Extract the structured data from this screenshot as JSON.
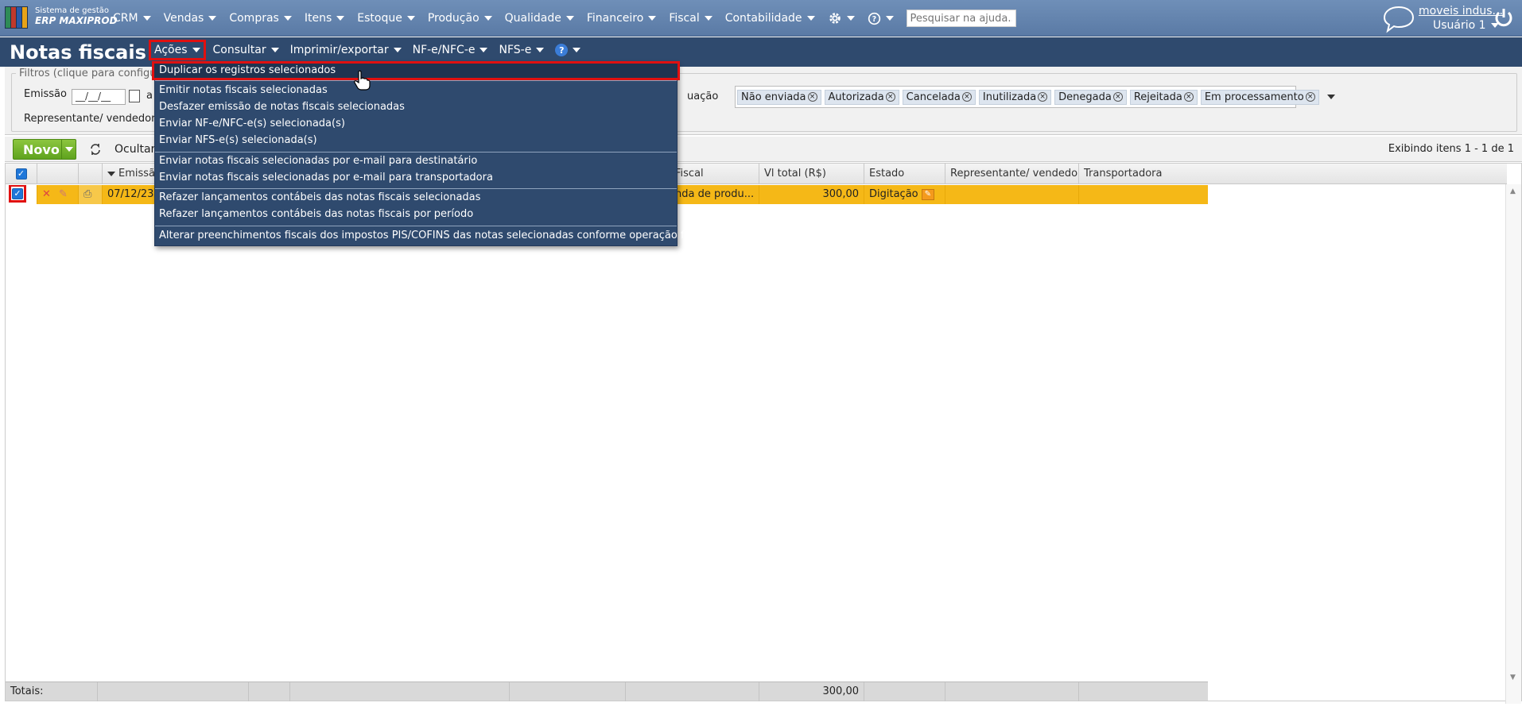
{
  "app": {
    "logo_line1": "Sistema de gestão",
    "logo_line2": "ERP MAXIPROD",
    "brand_colors": [
      "#2e8b57",
      "#c0392b",
      "#2a5aa8",
      "#e8a317"
    ]
  },
  "topnav": {
    "items": [
      "CRM",
      "Vendas",
      "Compras",
      "Itens",
      "Estoque",
      "Produção",
      "Qualidade",
      "Financeiro",
      "Fiscal",
      "Contabilidade"
    ],
    "search_placeholder": "Pesquisar na ajuda...",
    "company": "moveis indus...",
    "user": "Usuário 1"
  },
  "page": {
    "title": "Notas fiscais",
    "menus": [
      "Ações",
      "Consultar",
      "Imprimir/exportar",
      "NF-e/NFC-e",
      "NFS-e"
    ],
    "help_symbol": "?"
  },
  "filters": {
    "legend": "Filtros (clique para configu",
    "emissao_label": "Emissão",
    "emissao_from": "__/__/__",
    "emissao_to_label": "a",
    "representante_label": "Representante/ vendedor",
    "situacao_label": "uação",
    "situacao_chips": [
      "Não enviada",
      "Autorizada",
      "Cancelada",
      "Inutilizada",
      "Denegada",
      "Rejeitada",
      "Em processamento"
    ]
  },
  "toolbar": {
    "novo_label": "Novo",
    "ocultar_label": "Ocultar",
    "exibindo": "Exibindo itens 1 - 1 de 1"
  },
  "grid": {
    "headers": [
      "Emissão",
      "Fiscal",
      "Vl total (R$)",
      "Estado",
      "Representante/ vendedor",
      "Transportadora"
    ],
    "row": {
      "emissao": "07/12/23",
      "operacao": "nda de produ...",
      "valor": "300,00",
      "estado": "Digitação"
    },
    "totals_label": "Totais:",
    "totals_value": "300,00"
  },
  "dropdown": {
    "items": [
      "Duplicar os registros selecionados",
      "Emitir notas fiscais selecionadas",
      "Desfazer emissão de notas fiscais selecionadas",
      "Enviar NF-e/NFC-e(s) selecionada(s)",
      "Enviar NFS-e(s) selecionada(s)",
      "Enviar notas fiscais selecionadas por e-mail para destinatário",
      "Enviar notas fiscais selecionadas por e-mail para transportadora",
      "Refazer lançamentos contábeis das notas fiscais selecionadas",
      "Refazer lançamentos contábeis das notas fiscais por período",
      "Alterar preenchimentos fiscais dos impostos PIS/COFINS das notas selecionadas conforme operação fiscal"
    ]
  },
  "colors": {
    "nav_bg": "#5a7aa5",
    "title_bg": "#2f4a6e",
    "row_selected": "#f5b817",
    "highlight": "#e01010",
    "novo_green": "#5fa31e"
  }
}
